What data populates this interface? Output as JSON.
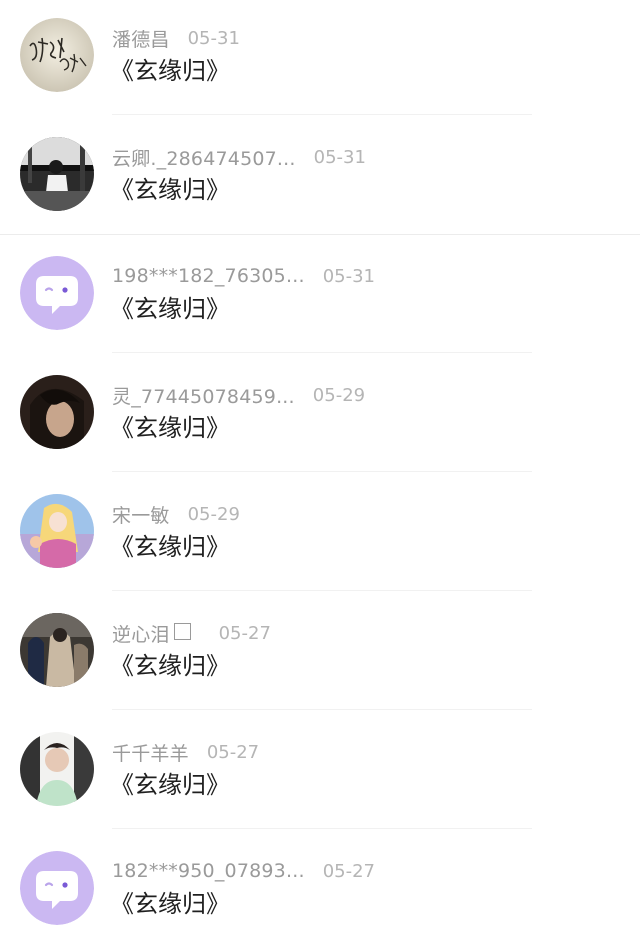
{
  "comments": [
    {
      "username": "潘德昌",
      "date": "05-31",
      "message": "《玄缘归》",
      "avatar_icon": "calligraphy-avatar"
    },
    {
      "username": "云卿._286474507...",
      "date": "05-31",
      "message": "《玄缘归》",
      "avatar_icon": "photo-avatar"
    },
    {
      "username": "198***182_76305...",
      "date": "05-31",
      "message": "《玄缘归》",
      "avatar_icon": "chat-bubble-default-avatar"
    },
    {
      "username": "灵_77445078459...",
      "date": "05-29",
      "message": "《玄缘归》",
      "avatar_icon": "portrait-avatar"
    },
    {
      "username": "宋一敏",
      "date": "05-29",
      "message": "《玄缘归》",
      "avatar_icon": "anime-avatar"
    },
    {
      "username": "逆心泪",
      "date": "05-27",
      "message": "《玄缘归》",
      "avatar_icon": "street-photo-avatar",
      "name_suffix_icon": "empty-box-glyph"
    },
    {
      "username": "千千羊羊",
      "date": "05-27",
      "message": "《玄缘归》",
      "avatar_icon": "portrait-avatar"
    },
    {
      "username": "182***950_07893...",
      "date": "05-27",
      "message": "《玄缘归》",
      "avatar_icon": "chat-bubble-default-avatar"
    }
  ],
  "colors": {
    "username": "#9a9a9a",
    "date": "#b5b5b5",
    "message": "#1f1f1f",
    "default_avatar_bg": "#cbb8f2"
  }
}
